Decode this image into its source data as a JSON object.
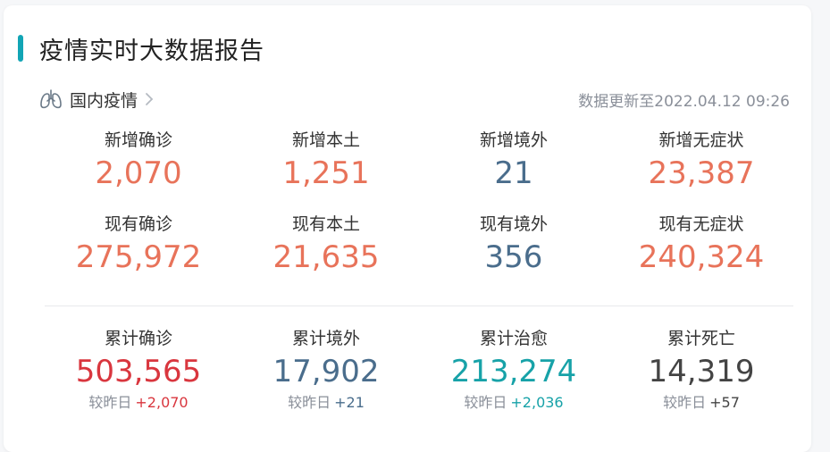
{
  "header": {
    "title": "疫情实时大数据报告"
  },
  "subheader": {
    "section_label": "国内疫情",
    "update_text": "数据更新至2022.04.12 09:26"
  },
  "colors": {
    "accent": "#12a5b5",
    "orange": "#e8735a",
    "blue": "#4a6d8c",
    "red": "#d9363e",
    "teal": "#17a2a8",
    "dark": "#444444"
  },
  "row1": [
    {
      "label": "新增确诊",
      "value": "2,070",
      "color": "#e8735a"
    },
    {
      "label": "新增本土",
      "value": "1,251",
      "color": "#e8735a"
    },
    {
      "label": "新增境外",
      "value": "21",
      "color": "#4a6d8c"
    },
    {
      "label": "新增无症状",
      "value": "23,387",
      "color": "#e8735a"
    }
  ],
  "row2": [
    {
      "label": "现有确诊",
      "value": "275,972",
      "color": "#e8735a"
    },
    {
      "label": "现有本土",
      "value": "21,635",
      "color": "#e8735a"
    },
    {
      "label": "现有境外",
      "value": "356",
      "color": "#4a6d8c"
    },
    {
      "label": "现有无症状",
      "value": "240,324",
      "color": "#e8735a"
    }
  ],
  "row3": [
    {
      "label": "累计确诊",
      "value": "503,565",
      "color": "#d9363e",
      "cmp_label": "较昨日",
      "delta": "+2,070",
      "delta_color": "#d9363e"
    },
    {
      "label": "累计境外",
      "value": "17,902",
      "color": "#4a6d8c",
      "cmp_label": "较昨日",
      "delta": "+21",
      "delta_color": "#4a6d8c"
    },
    {
      "label": "累计治愈",
      "value": "213,274",
      "color": "#17a2a8",
      "cmp_label": "较昨日",
      "delta": "+2,036",
      "delta_color": "#17a2a8"
    },
    {
      "label": "累计死亡",
      "value": "14,319",
      "color": "#444444",
      "cmp_label": "较昨日",
      "delta": "+57",
      "delta_color": "#444444"
    }
  ]
}
